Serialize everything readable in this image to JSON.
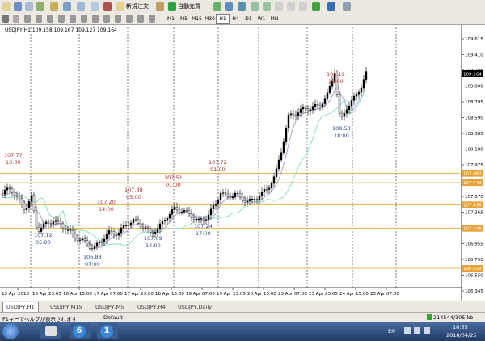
{
  "toolbar": {
    "new_order_label": "新規注文",
    "autotrade_label": "自動売買",
    "timeframes": [
      "M1",
      "M5",
      "M15",
      "M30",
      "H1",
      "H4",
      "D1",
      "W1",
      "MN"
    ],
    "active_timeframe": "H1"
  },
  "chart": {
    "info": "USDJPY,H1  109.158 109.167 109.127 109.164",
    "y_labels": [
      "109.615",
      "109.410",
      "109.205",
      "109.000",
      "108.795",
      "108.590",
      "108.385",
      "108.180",
      "107.975",
      "107.775",
      "107.570",
      "107.365",
      "107.160",
      "106.955",
      "106.750",
      "106.550",
      "106.345"
    ],
    "x_labels": [
      "13 Apr 2018",
      "15 Apr 23:05",
      "16 Apr 15:00",
      "17 Apr 07:00",
      "17 Apr 23:00",
      "18 Apr 15:00",
      "19 Apr 07:00",
      "19 Apr 23:05",
      "20 Apr 15:00",
      "23 Apr 07:00",
      "23 Apr 23:05",
      "24 Apr 15:00",
      "25 Apr 07:00"
    ],
    "current_price": "109.164",
    "hline_labels": [
      "107.863",
      "107.743",
      "107.456",
      "107.148",
      "106.629"
    ],
    "annotations": [
      {
        "price": "107.77",
        "time": "13:00"
      },
      {
        "price": "107.12",
        "time": "05:00"
      },
      {
        "price": "106.88",
        "time": "07:00"
      },
      {
        "price": "107.20",
        "time": "14:00"
      },
      {
        "price": "107.38",
        "time": "05:00"
      },
      {
        "price": "107.09",
        "time": "14:00"
      },
      {
        "price": "107.51",
        "time": "01:00"
      },
      {
        "price": "107.24",
        "time": "17:00"
      },
      {
        "price": "107.72",
        "time": "01:00"
      },
      {
        "price": "109.19",
        "time": "15:00"
      },
      {
        "price": "108.53",
        "time": "18:00"
      }
    ],
    "colors": {
      "up_candle": "#000000",
      "hline": "#e8a030",
      "ma_fast": "#a7a3d6",
      "ma_slow": "#8fe0c0",
      "annotation_red": "#b03030",
      "annotation_blue": "#2d4a8f"
    }
  },
  "tabs": [
    "USDJPY,H1",
    "USDJPY,M15",
    "USDJPY,M5",
    "USDJPY,H4",
    "USDJPY,Daily"
  ],
  "status": {
    "help": "F1キーでヘルプが表示されます",
    "profile": "Default",
    "traffic": "214544/105 kb"
  },
  "taskbar": {
    "lang": "EN",
    "time": "16:55",
    "date": "2018/04/25",
    "badge6": "6",
    "badge1": "1"
  }
}
